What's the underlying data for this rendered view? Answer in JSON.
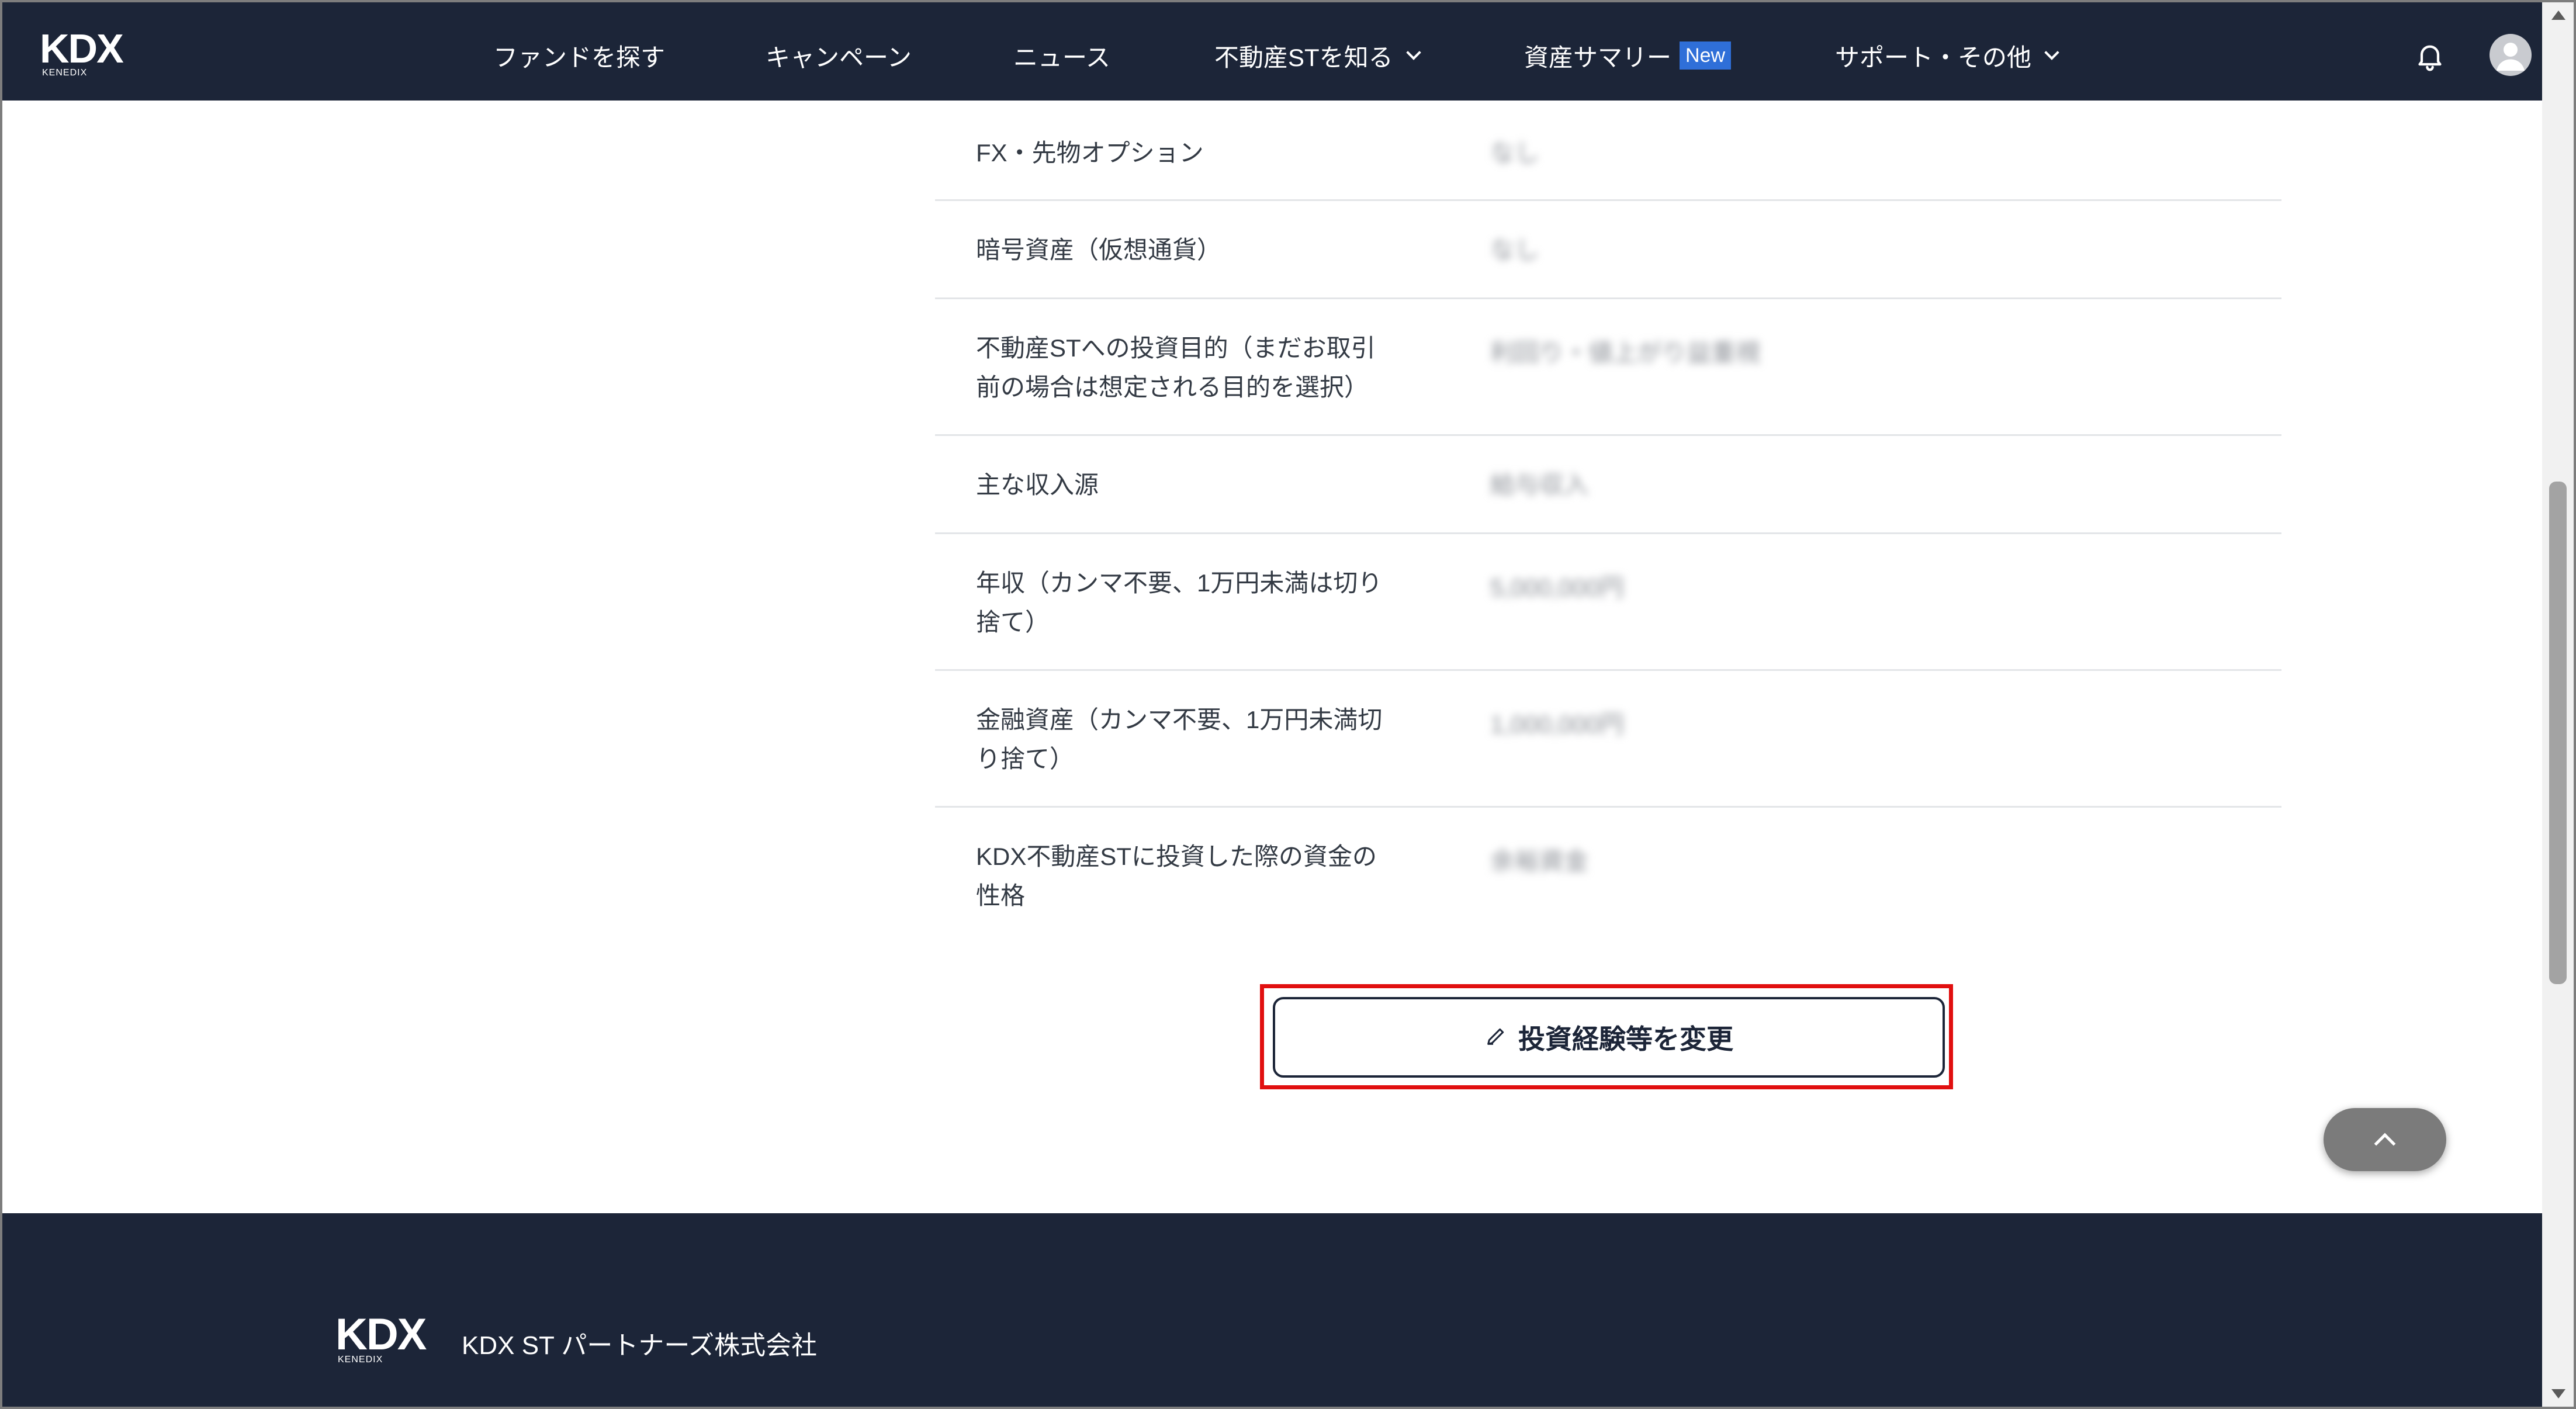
{
  "header": {
    "logo": {
      "text": "KDX",
      "sub": "KENEDIX"
    },
    "nav": [
      {
        "label": "ファンドを探す"
      },
      {
        "label": "キャンペーン"
      },
      {
        "label": "ニュース"
      },
      {
        "label": "不動産STを知る"
      },
      {
        "label": "資産サマリー",
        "badge": "New"
      },
      {
        "label": "サポート・その他"
      }
    ]
  },
  "rows": [
    {
      "label": "FX・先物オプション",
      "value": "なし"
    },
    {
      "label": "暗号資産（仮想通貨）",
      "value": "なし"
    },
    {
      "label": "不動産STへの投資目的（まだお取引前の場合は想定される目的を選択）",
      "value": "利回り・値上がり益重視"
    },
    {
      "label": "主な収入源",
      "value": "給与収入"
    },
    {
      "label": "年収（カンマ不要、1万円未満は切り捨て）",
      "value": "5,000,000円"
    },
    {
      "label": "金融資産（カンマ不要、1万円未満切り捨て）",
      "value": "1,000,000円"
    },
    {
      "label": "KDX不動産STに投資した際の資金の性格",
      "value": "余裕資金"
    }
  ],
  "edit_button": {
    "label": "投資経験等を変更"
  },
  "footer": {
    "logo_text": "KDX",
    "logo_sub": "KENEDIX",
    "company": "KDX ST パートナーズ株式会社"
  },
  "colors": {
    "navy": "#1c2538",
    "accent_blue": "#2f6fd8",
    "highlight_red": "#e10f0f"
  }
}
